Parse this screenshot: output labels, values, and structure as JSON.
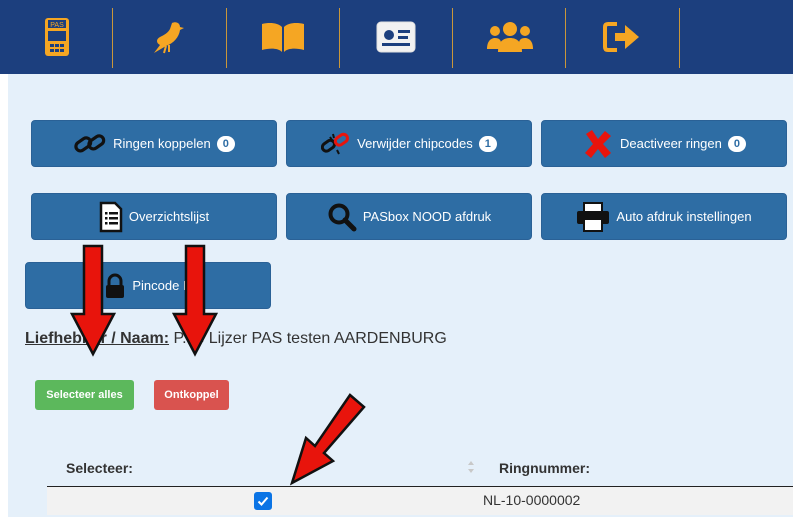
{
  "nav": {
    "items": [
      {
        "icon": "pasbox-device-icon"
      },
      {
        "icon": "pigeon-icon"
      },
      {
        "icon": "open-book-icon"
      },
      {
        "icon": "id-card-icon"
      },
      {
        "icon": "users-group-icon"
      },
      {
        "icon": "sign-out-icon"
      },
      {
        "icon": ""
      }
    ],
    "pas_label": "PAS",
    "colors": {
      "bar": "#1c3f7e",
      "icon": "#f5a623"
    }
  },
  "actions": {
    "couple_rings": {
      "label": "Ringen koppelen",
      "badge": "0",
      "icon": "link-icon"
    },
    "remove_chipcodes": {
      "label": "Verwijder chipcodes",
      "badge": "1",
      "icon": "broken-link-icon"
    },
    "deactivate_rings": {
      "label": "Deactiveer ringen",
      "badge": "0",
      "icon": "red-x-icon"
    },
    "overview_list": {
      "label": "Overzichtslijst",
      "icon": "list-document-icon"
    },
    "emergency_print": {
      "label": "PASbox NOOD afdruk",
      "icon": "magnifier-icon"
    },
    "auto_print": {
      "label": "Auto afdruk instellingen",
      "icon": "printer-icon"
    },
    "pincode": {
      "label": "Pincode E",
      "icon": "lock-icon"
    }
  },
  "owner": {
    "label": "Liefhebber / Naam:",
    "value": "P.de Lijzer PAS testen AARDENBURG"
  },
  "list_actions": {
    "select_all": "Selecteer alles",
    "uncouple": "Ontkoppel"
  },
  "table": {
    "columns": [
      "Selecteer:",
      "Ringnummer:"
    ],
    "rows": [
      {
        "selected": true,
        "ring_number": "NL-10-0000002"
      }
    ]
  },
  "colors": {
    "primary_button": "#2e6da4",
    "success": "#5cb85c",
    "danger": "#d9534f",
    "annotation_arrow": "#e8140c",
    "content_background": "#e5f0fa"
  }
}
